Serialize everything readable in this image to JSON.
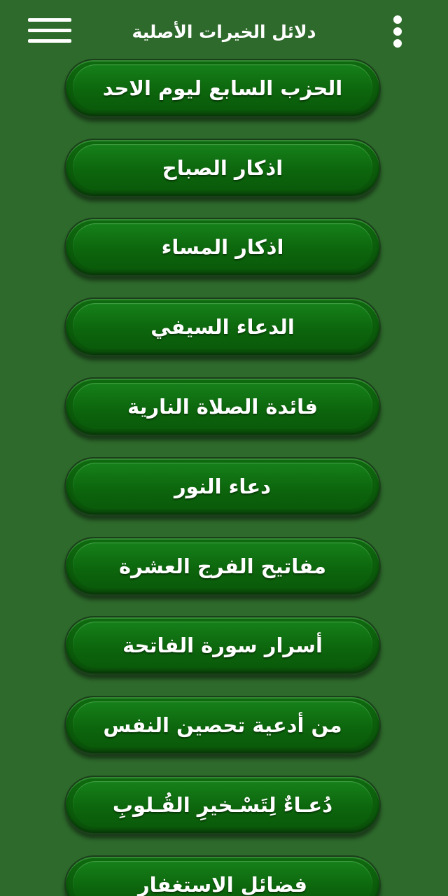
{
  "app_bar": {
    "title": "دلائل الخيرات الأصلية"
  },
  "menu_items": [
    {
      "label": "الحزب السابع ليوم الاحد"
    },
    {
      "label": "اذكار الصباح"
    },
    {
      "label": "اذكار المساء"
    },
    {
      "label": "الدعاء السيفي"
    },
    {
      "label": "فائدة الصلاة النارية"
    },
    {
      "label": "دعاء النور"
    },
    {
      "label": "مفاتيح الفرج العشرة"
    },
    {
      "label": "أسرار سورة الفاتحة"
    },
    {
      "label": "من أدعية تحصين النفس"
    },
    {
      "label": "دُعـاءٌ لِتَسْـخيرِ القُـلوبِ"
    },
    {
      "label": "فضائل الاستغفار"
    }
  ],
  "colors": {
    "background": "#2e6a2c",
    "button": "#0b5c0b",
    "text": "#ffffff"
  },
  "icons": {
    "menu": "hamburger-icon",
    "overflow": "more-vertical-icon"
  }
}
